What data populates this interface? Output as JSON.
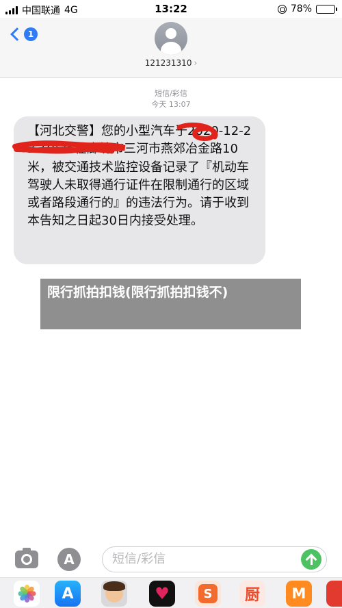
{
  "status_bar": {
    "carrier": "中国联通",
    "network": "4G",
    "time": "13:22",
    "battery_text": "78%",
    "battery_level": 0.78,
    "icons": [
      "signal-bars-icon",
      "orientation-lock-icon",
      "battery-icon"
    ]
  },
  "header": {
    "back_badge": "1",
    "contact_number": "121231310",
    "contact_chevron": "›"
  },
  "thread": {
    "channel": "短信/彩信",
    "timestamp": "今天 13:07"
  },
  "message": {
    "text": "【河北交警】您的小型汽车于2020-12-22 19:25在廊坊市三河市燕郊冶金路10米，被交通技术监控设备记录了『机动车驾驶人未取得通行证件在限制通行的区域或者路段通行的』的违法行为。请于收到本告知之日起30日内接受处理。"
  },
  "overlay": {
    "title": "限行抓拍扣钱(限行抓拍扣钱不)"
  },
  "composer": {
    "placeholder": "短信/彩信",
    "appstore_glyph": "A",
    "icons": [
      "camera-icon",
      "app-store-icon",
      "send-arrow-icon"
    ]
  },
  "app_drawer": {
    "apps": [
      {
        "name": "photos",
        "glyph": ""
      },
      {
        "name": "app-store",
        "glyph": "A"
      },
      {
        "name": "memoji",
        "glyph": ""
      },
      {
        "name": "heart-app",
        "glyph": "♥"
      },
      {
        "name": "s-app",
        "glyph": "S"
      },
      {
        "name": "kitchen-app",
        "glyph": "厨"
      },
      {
        "name": "mango-tv",
        "glyph": "M"
      },
      {
        "name": "partial-app",
        "glyph": ""
      }
    ]
  },
  "colors": {
    "accent_blue": "#2f7cf6",
    "bubble_gray": "#e7e7ea",
    "send_green": "#4cc262",
    "scribble_red": "#e0241b",
    "banner_gray": "#808080"
  }
}
